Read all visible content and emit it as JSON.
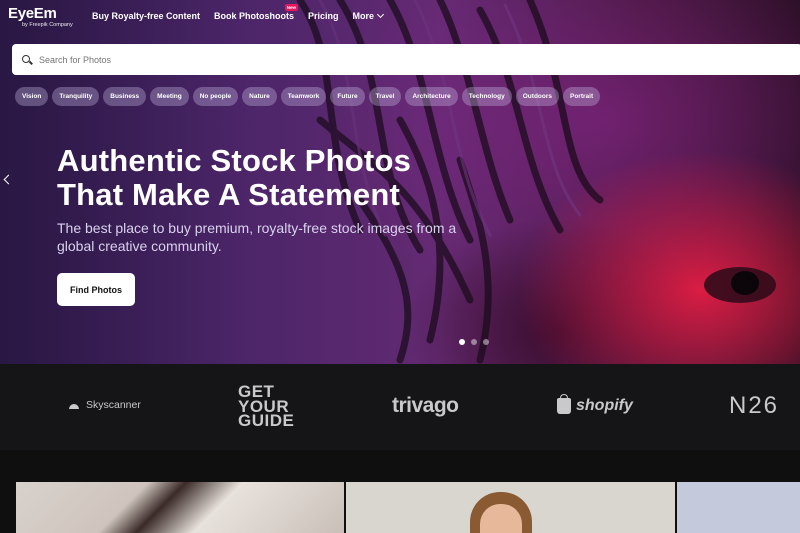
{
  "brand": {
    "name": "EyeEm",
    "byline": "by Freepik Company"
  },
  "nav": {
    "links": [
      {
        "label": "Buy Royalty-free Content"
      },
      {
        "label": "Book Photoshoots",
        "badge": "New"
      },
      {
        "label": "Pricing"
      },
      {
        "label": "More"
      }
    ]
  },
  "search": {
    "placeholder": "Search for Photos"
  },
  "tags": [
    "Vision",
    "Tranquility",
    "Business",
    "Meeting",
    "No people",
    "Nature",
    "Teamwork",
    "Future",
    "Travel",
    "Architecture",
    "Technology",
    "Outdoors",
    "Portrait"
  ],
  "hero": {
    "headline_line1": "Authentic Stock Photos",
    "headline_line2": "That Make A Statement",
    "subline": "The best place to buy premium, royalty-free stock images from a global creative community.",
    "cta": "Find Photos",
    "slides": 3,
    "active_slide": 1
  },
  "partners": {
    "skyscanner": "Skyscanner",
    "getyourguide": [
      "GET",
      "YOUR",
      "GUIDE"
    ],
    "trivago": "trivago",
    "shopify": "shopify",
    "n26": "N26"
  },
  "colors": {
    "accent": "#e8175d",
    "logobar": "#151517",
    "hero": "#5a2c7a"
  }
}
